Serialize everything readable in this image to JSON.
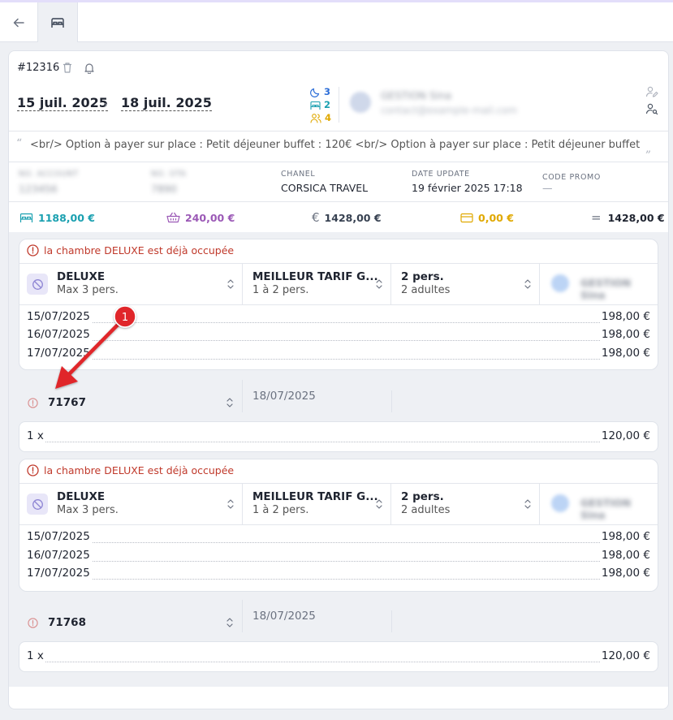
{
  "topbar": {
    "back": "arrow-left-icon",
    "tab": "bed-icon"
  },
  "reservation": {
    "id": "#12316",
    "date_start": "15 juil. 2025",
    "date_end": "18 juil. 2025",
    "nights": "3",
    "rooms": "2",
    "persons": "4",
    "customer_name": "GESTION Sina",
    "customer_email": "contact@example-mail.com"
  },
  "note": "<br/> Option à payer sur place : Petit déjeuner buffet : 120€ <br/> Option à payer sur place : Petit déjeuner buffet : 12...",
  "info": {
    "blur1_label": "NO. ACCOUNT",
    "blur1_value": "123456",
    "blur2_label": "NO. OTA",
    "blur2_value": "7890",
    "chanel_label": "CHANEL",
    "chanel_value": "CORSICA TRAVEL",
    "update_label": "DATE UPDATE",
    "update_value": "19 février 2025 17:18",
    "promo_label": "CODE PROMO",
    "promo_value": "—"
  },
  "totals": {
    "rooms": "1188,00 €",
    "options": "240,00 €",
    "amount": "1428,00 €",
    "paid": "0,00 €",
    "total": "1428,00 €"
  },
  "colors": {
    "teal": "#1aa0b0",
    "purple": "#9b59b6",
    "gold": "#e0a800",
    "blue": "#2e6fd8",
    "red": "#c0392b"
  },
  "rooms": [
    {
      "warning": "la chambre DELUXE est déjà occupée",
      "room_name": "DELUXE",
      "room_cap": "Max 3 pers.",
      "rate_name": "MEILLEUR TARIF G...",
      "rate_cap": "1 à 2 pers.",
      "pers": "2 pers.",
      "pers_detail": "2 adultes",
      "guest": "GESTION Sina",
      "nights": [
        {
          "date": "15/07/2025",
          "price": "198,00 €"
        },
        {
          "date": "16/07/2025",
          "price": "198,00 €"
        },
        {
          "date": "17/07/2025",
          "price": "198,00 €"
        }
      ],
      "option_code": "71767",
      "option_date": "18/07/2025",
      "extra_qty": "1 x",
      "extra_price": "120,00 €"
    },
    {
      "warning": "la chambre DELUXE est déjà occupée",
      "room_name": "DELUXE",
      "room_cap": "Max 3 pers.",
      "rate_name": "MEILLEUR TARIF G...",
      "rate_cap": "1 à 2 pers.",
      "pers": "2 pers.",
      "pers_detail": "2 adultes",
      "guest": "GESTION Sina",
      "nights": [
        {
          "date": "15/07/2025",
          "price": "198,00 €"
        },
        {
          "date": "16/07/2025",
          "price": "198,00 €"
        },
        {
          "date": "17/07/2025",
          "price": "198,00 €"
        }
      ],
      "option_code": "71768",
      "option_date": "18/07/2025",
      "extra_qty": "1 x",
      "extra_price": "120,00 €"
    }
  ],
  "annotation": {
    "marker": "1"
  }
}
